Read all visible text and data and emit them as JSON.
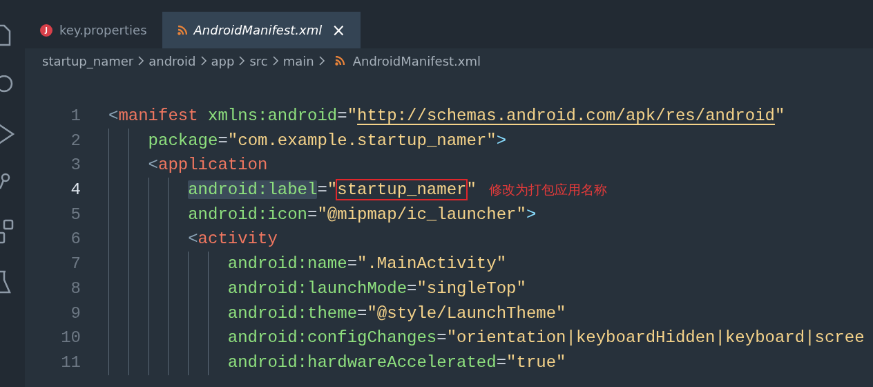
{
  "activity_bar": [
    {
      "kind": "files"
    },
    {
      "kind": "search"
    },
    {
      "kind": "run"
    },
    {
      "kind": "source-control"
    },
    {
      "kind": "extensions"
    },
    {
      "kind": "testing"
    }
  ],
  "tabs": [
    {
      "label": "key.properties",
      "icon_letter": "J",
      "kind": "properties",
      "selected": false
    },
    {
      "label": "AndroidManifest.xml",
      "kind": "xml",
      "selected": true,
      "close": "×"
    }
  ],
  "breadcrumb": [
    {
      "label": "startup_namer",
      "kind": "folder"
    },
    {
      "label": "android",
      "kind": "folder"
    },
    {
      "label": "app",
      "kind": "folder"
    },
    {
      "label": "src",
      "kind": "folder"
    },
    {
      "label": "main",
      "kind": "folder"
    },
    {
      "label": "AndroidManifest.xml",
      "kind": "xml"
    }
  ],
  "lines": [
    {
      "number": "1",
      "current": false,
      "tokens": [
        {
          "kind": "open",
          "text": "<"
        },
        {
          "kind": "tag",
          "text": "manifest"
        },
        {
          "kind": "attr",
          "text": "xmlns:android"
        },
        {
          "kind": "eq",
          "text": "="
        },
        {
          "kind": "string",
          "text": "\""
        },
        {
          "kind": "link",
          "text": "http://schemas.android.com/apk/res/android"
        },
        {
          "kind": "string",
          "text": "\""
        }
      ],
      "children": [
        {
          "number": "2",
          "current": false,
          "tokens": [
            {
              "kind": "attr",
              "text": "package"
            },
            {
              "kind": "eq",
              "text": "="
            },
            {
              "kind": "string",
              "text": "\"com.example.startup_namer\""
            },
            {
              "kind": "close",
              "text": ">"
            }
          ]
        },
        {
          "number": "3",
          "current": false,
          "tokens": [
            {
              "kind": "open",
              "text": "<"
            },
            {
              "kind": "tag",
              "text": "application"
            }
          ],
          "children": [
            {
              "number": "4",
              "current": true,
              "note": "修改为打包应用名称",
              "tokens": [
                {
                  "kind": "attr",
                  "text": "android:label",
                  "highlighted": true
                },
                {
                  "kind": "eq",
                  "text": "="
                },
                {
                  "kind": "string",
                  "text": "\""
                },
                {
                  "kind": "string",
                  "text": "startup_namer",
                  "boxed": true
                },
                {
                  "kind": "string",
                  "text": "\""
                }
              ]
            },
            {
              "number": "5",
              "current": false,
              "tokens": [
                {
                  "kind": "attr",
                  "text": "android:icon"
                },
                {
                  "kind": "eq",
                  "text": "="
                },
                {
                  "kind": "string",
                  "text": "\"@mipmap/ic_launcher\""
                },
                {
                  "kind": "close",
                  "text": ">"
                }
              ]
            },
            {
              "number": "6",
              "current": false,
              "tokens": [
                {
                  "kind": "open",
                  "text": "<"
                },
                {
                  "kind": "tag",
                  "text": "activity"
                }
              ],
              "children": [
                {
                  "number": "7",
                  "current": false,
                  "tokens": [
                    {
                      "kind": "attr",
                      "text": "android:name"
                    },
                    {
                      "kind": "eq",
                      "text": "="
                    },
                    {
                      "kind": "string",
                      "text": "\".MainActivity\""
                    }
                  ]
                },
                {
                  "number": "8",
                  "current": false,
                  "tokens": [
                    {
                      "kind": "attr",
                      "text": "android:launchMode"
                    },
                    {
                      "kind": "eq",
                      "text": "="
                    },
                    {
                      "kind": "string",
                      "text": "\"singleTop\""
                    }
                  ]
                },
                {
                  "number": "9",
                  "current": false,
                  "tokens": [
                    {
                      "kind": "attr",
                      "text": "android:theme"
                    },
                    {
                      "kind": "eq",
                      "text": "="
                    },
                    {
                      "kind": "string",
                      "text": "\"@style/LaunchTheme\""
                    }
                  ]
                },
                {
                  "number": "10",
                  "current": false,
                  "tokens": [
                    {
                      "kind": "attr",
                      "text": "android:configChanges"
                    },
                    {
                      "kind": "eq",
                      "text": "="
                    },
                    {
                      "kind": "string",
                      "text": "\"orientation|keyboardHidden|keyboard|scree"
                    }
                  ]
                },
                {
                  "number": "11",
                  "current": false,
                  "tokens": [
                    {
                      "kind": "attr",
                      "text": "android:hardwareAccelerated"
                    },
                    {
                      "kind": "eq",
                      "text": "="
                    },
                    {
                      "kind": "string",
                      "text": "\"true\""
                    }
                  ]
                }
              ]
            }
          ]
        }
      ]
    }
  ]
}
